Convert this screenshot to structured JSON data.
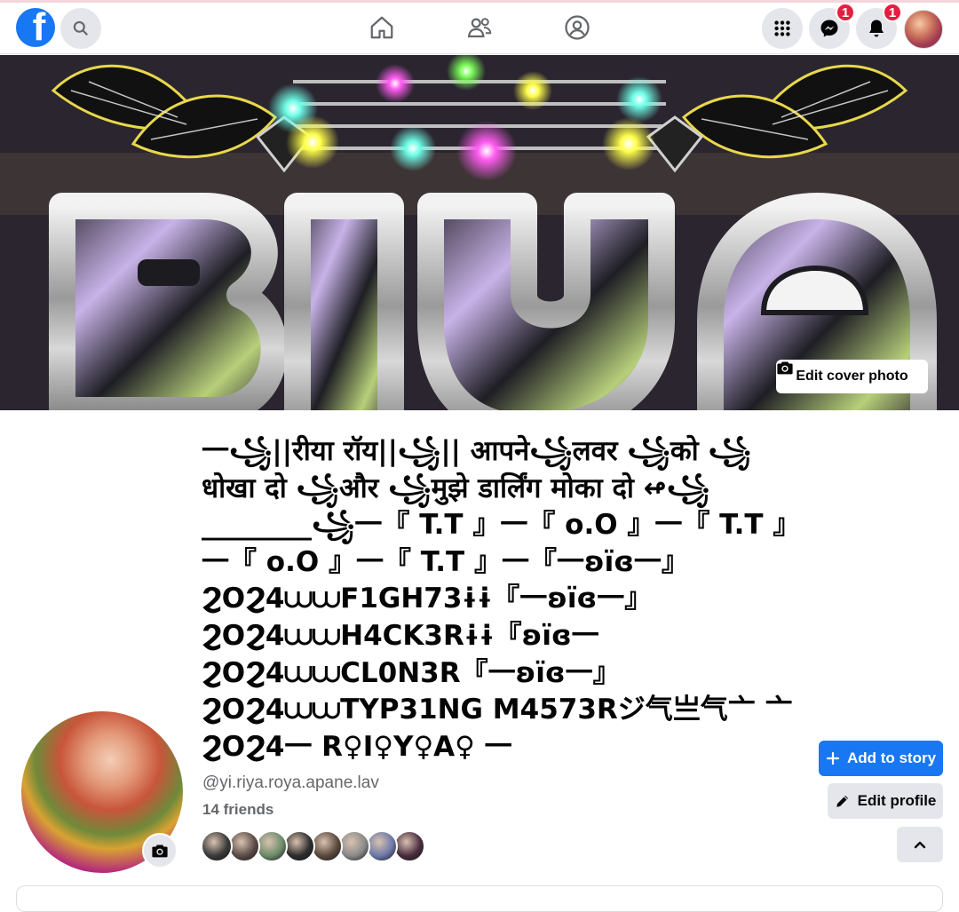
{
  "navbar": {
    "logo_letter": "f",
    "messenger_badge": "1",
    "notifications_badge": "1"
  },
  "cover": {
    "edit_label": "Edit cover photo",
    "art_text": "RIYA"
  },
  "profile": {
    "name": "一꧁||रीया रॉय||꧁|| आपने꧁लवर ꧁को ꧁धोखा दो ꧁और ꧁मुझे डार्लिंग मोका दो ↫꧁________꧁一『 T.T 』一『 o.O 』一『 T.T 』一『 o.O 』一『 T.T 』一『一ʚïɞ一』ϨOϨ4⩊⩊F1GH73ɨɨ『一ʚïɞ一』ϨOϨ4⩊⩊H4CK3Rɨɨ『ʚïɞ一 ϨOϨ4⩊⩊CL0N3R『一ʚïɞ一』ϨOϨ4⩊⩊TYP31NG M4573Rジ气亗气亠 亠 ϨOϨ4一 R♀I♀Y♀A♀ 一",
    "username": "@yi.riya.roya.apane.lav",
    "friends_count": "14 friends"
  },
  "actions": {
    "add_story_label": "Add to story",
    "edit_profile_label": "Edit profile"
  },
  "colors": {
    "brand": "#1877f2",
    "badge": "#e41e3f",
    "button_gray": "#e4e6eb"
  },
  "friend_avatars": [
    "#3a3a3a",
    "#5b4c48",
    "#6c8b6a",
    "#2d2d2d",
    "#5a4a3e",
    "#8a8a8a",
    "#6d79a8",
    "#4a2c3e"
  ]
}
